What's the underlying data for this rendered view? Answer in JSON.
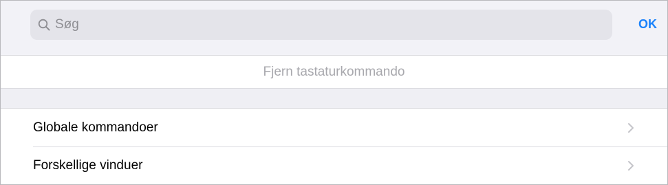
{
  "search": {
    "placeholder": "Søg",
    "value": "",
    "icon": "search-icon"
  },
  "ok_label": "OK",
  "remove_label": "Fjern tastaturkommando",
  "items": [
    {
      "label": "Globale kommandoer",
      "icon": "chevron-right-icon"
    },
    {
      "label": "Forskellige vinduer",
      "icon": "chevron-right-icon"
    }
  ],
  "colors": {
    "accent": "#1a82fb",
    "disabled_text": "#a8a8ad",
    "search_field": "#e4e4ea"
  }
}
